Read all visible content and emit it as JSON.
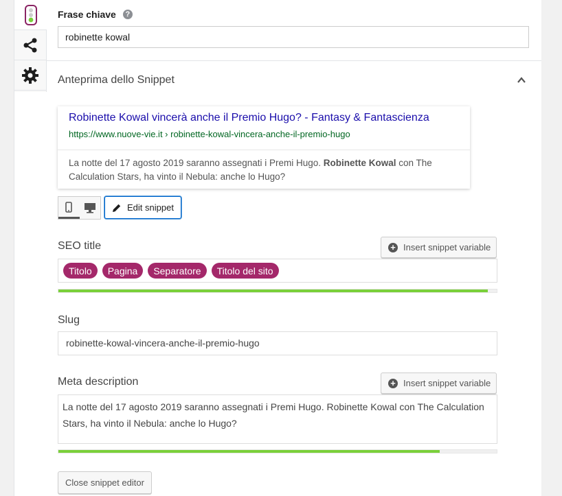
{
  "sidebar": {
    "tabs": [
      {
        "icon": "traffic-light-icon"
      },
      {
        "icon": "share-icon"
      },
      {
        "icon": "gear-icon"
      }
    ]
  },
  "keyword": {
    "label": "Frase chiave",
    "help_icon": "question-mark-icon",
    "value": "robinette kowal"
  },
  "snippet_preview": {
    "header": "Anteprima dello Snippet",
    "serp": {
      "title": "Robinette Kowal vincerà anche il Premio Hugo? - Fantasy & Fantascienza",
      "url": "https://www.nuove-vie.it › robinette-kowal-vincera-anche-il-premio-hugo",
      "description_parts": [
        "La notte del 17 agosto 2019 saranno assegnati i Premi Hugo. ",
        "Robinette Kowal",
        " con The Calculation Stars, ha vinto il Nebula: anche lo Hugo?"
      ]
    },
    "device": {
      "selected": "mobile",
      "options": [
        "mobile-icon",
        "desktop-icon"
      ]
    },
    "edit_button": "Edit snippet"
  },
  "seo_title": {
    "label": "SEO title",
    "insert_button": "Insert snippet variable",
    "variables": [
      "Titolo",
      "Pagina",
      "Separatore",
      "Titolo del sito"
    ],
    "progress": 0.98,
    "progress_color": "#7ad03a"
  },
  "slug": {
    "label": "Slug",
    "value": "robinette-kowal-vincera-anche-il-premio-hugo"
  },
  "meta_description": {
    "label": "Meta description",
    "insert_button": "Insert snippet variable",
    "value": "La notte del 17 agosto 2019 saranno assegnati i Premi Hugo. Robinette Kowal con The Calculation Stars, ha vinto il Nebula: anche lo Hugo?",
    "progress": 0.87,
    "progress_color": "#7ad03a"
  },
  "close_button": "Close snippet editor",
  "colors": {
    "variable_pill": "#a4286a",
    "serp_title": "#1a0dab",
    "serp_url": "#006621",
    "accent": "#0066cd"
  }
}
